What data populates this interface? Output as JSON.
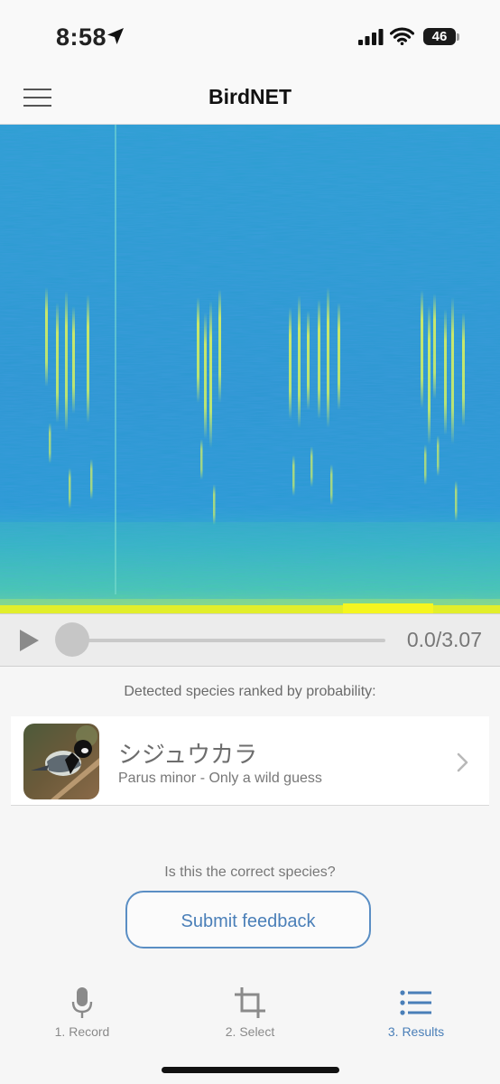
{
  "status_bar": {
    "time": "8:58",
    "battery": "46"
  },
  "header": {
    "title": "BirdNET",
    "menu_icon": "hamburger-menu-icon"
  },
  "player": {
    "time_readout": "0.0/3.07",
    "progress": 0.0
  },
  "results": {
    "heading": "Detected species ranked by probability:",
    "species": [
      {
        "common_name": "シジュウカラ",
        "scientific_line": "Parus minor - Only a wild guess"
      }
    ]
  },
  "feedback": {
    "question": "Is this the correct species?",
    "button_label": "Submit feedback"
  },
  "tabs": [
    {
      "label": "1. Record",
      "icon": "microphone-icon",
      "active": false
    },
    {
      "label": "2. Select",
      "icon": "crop-icon",
      "active": false
    },
    {
      "label": "3. Results",
      "icon": "list-icon",
      "active": true
    }
  ],
  "colors": {
    "accent": "#4a7fb8",
    "spectrogram_background": "#2a9fd0",
    "spectrogram_signal": "#d8f060",
    "spectrogram_peak": "#f2f21a"
  }
}
